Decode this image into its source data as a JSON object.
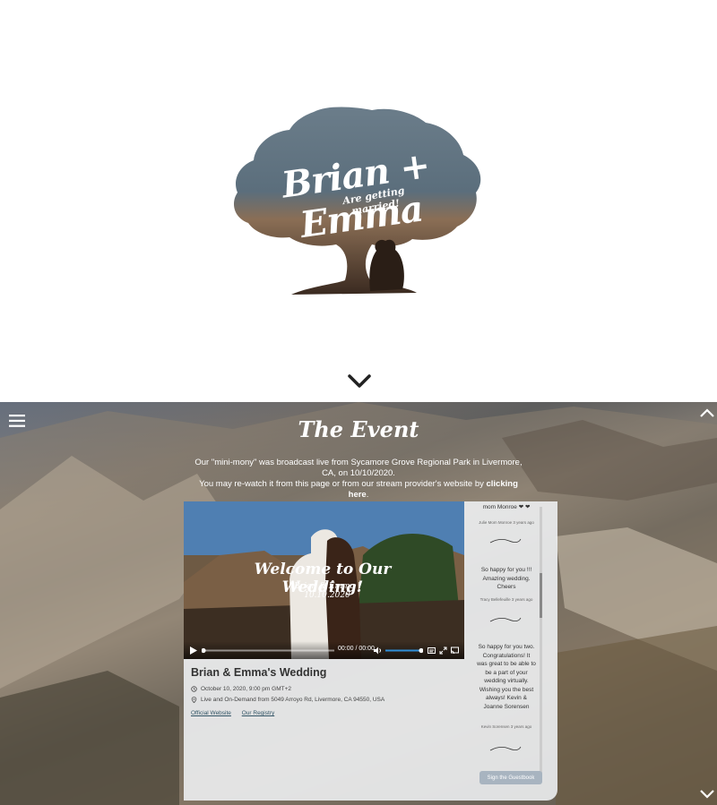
{
  "hero": {
    "names": "Brian + Emma",
    "tagline": "Are getting married!"
  },
  "event": {
    "title": "The Event",
    "desc_line1": "Our \"mini-mony\" was broadcast live from Sycamore Grove Regional Park in Livermore, CA, on 10/10/2020.",
    "desc_line2": "You may re-watch it from this page or from our stream provider's website by ",
    "desc_link": "clicking here",
    "desc_end": "."
  },
  "video": {
    "title": "Welcome to Our Wedding!",
    "subtitle": "Brian & Emma | 10.10.2020",
    "time": "00:00 / 00:00",
    "progress": 0,
    "volume": 1
  },
  "wedding": {
    "title": "Brian & Emma's Wedding",
    "date": "October 10, 2020, 9:00 pm GMT+2",
    "location": "Live and On-Demand from 5049 Arroyo Rd, Livermore, CA 94550, USA",
    "link1": "Official Website",
    "link2": "Our Registry"
  },
  "guestbook": {
    "top_fragment": "mom Monroe ❤ ❤",
    "entries": [
      {
        "meta": "Julie Mom Monroe 3 years ago",
        "message": ""
      },
      {
        "meta": "Tracy Bellefeuille 3 years ago",
        "message": "So happy for you !!! Amazing wedding. Cheers"
      },
      {
        "meta": "Kevin Sorensen 3 years ago",
        "message": "So happy for you two. Congratulations! It was great to be able to be a part of your wedding virtually. Wishing you the best always! Kevin & Joanne Sorensen"
      }
    ],
    "button": "Sign the Guestbook"
  },
  "colors": {
    "tree_top": "#5d7180",
    "tree_bottom": "#3a2a20",
    "accent": "#a8b4c0"
  }
}
